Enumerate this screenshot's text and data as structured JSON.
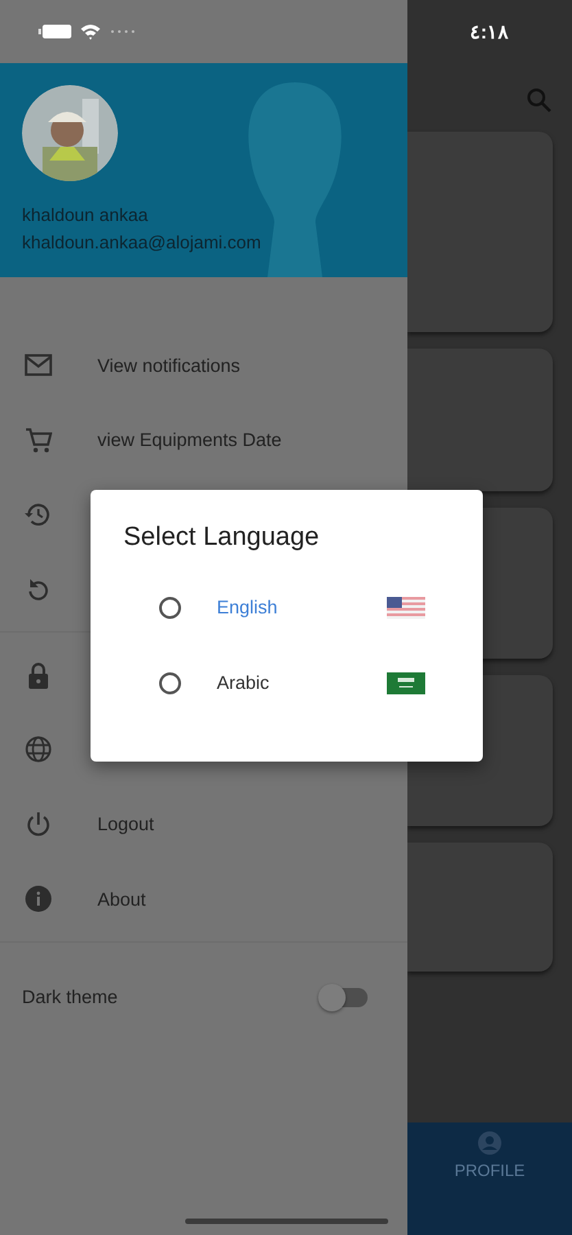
{
  "status_bar": {
    "time": "٤:١٨"
  },
  "drawer": {
    "user": {
      "name": "khaldoun ankaa",
      "email": "khaldoun.ankaa@alojami.com"
    },
    "menu_groups": [
      [
        {
          "kind": "mail",
          "label": "View notifications"
        },
        {
          "kind": "cart",
          "label": "view Equipments Date"
        },
        {
          "kind": "history"
        },
        {
          "kind": "refresh"
        }
      ],
      [
        {
          "kind": "lock"
        },
        {
          "kind": "globe"
        },
        {
          "kind": "power",
          "label": "Logout"
        },
        {
          "kind": "info",
          "label": "About"
        }
      ]
    ],
    "dark_theme": {
      "label": "Dark theme",
      "on": false
    }
  },
  "bottom_nav": {
    "items": [
      {
        "label": "PROFILE"
      }
    ]
  },
  "dialog": {
    "title": "Select Language",
    "options": [
      {
        "label": "English",
        "kind": "us",
        "selected": true,
        "checked": false
      },
      {
        "label": "Arabic",
        "kind": "sa",
        "selected": false,
        "checked": false
      }
    ]
  }
}
